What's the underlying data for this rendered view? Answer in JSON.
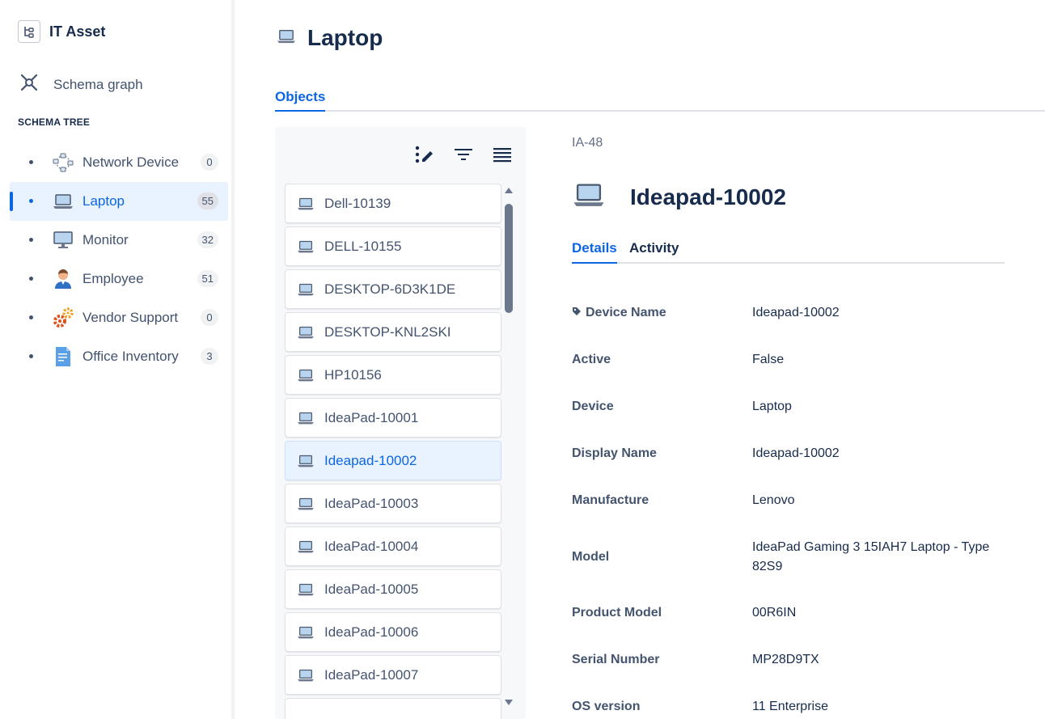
{
  "app": {
    "title": "IT Asset"
  },
  "nav": {
    "schema_graph": "Schema graph",
    "schema_tree_heading": "SCHEMA TREE"
  },
  "tree": [
    {
      "label": "Network Device",
      "count": "0",
      "icon": "network-device-icon"
    },
    {
      "label": "Laptop",
      "count": "55",
      "icon": "laptop-icon",
      "active": true
    },
    {
      "label": "Monitor",
      "count": "32",
      "icon": "monitor-icon"
    },
    {
      "label": "Employee",
      "count": "51",
      "icon": "employee-icon"
    },
    {
      "label": "Vendor Support",
      "count": "0",
      "icon": "gears-icon"
    },
    {
      "label": "Office Inventory",
      "count": "3",
      "icon": "document-icon"
    }
  ],
  "page": {
    "title": "Laptop",
    "tab_objects": "Objects"
  },
  "objects": [
    "Dell-10139",
    "DELL-10155",
    "DESKTOP-6D3K1DE",
    "DESKTOP-KNL2SKI",
    "HP10156",
    "IdeaPad-10001",
    "Ideapad-10002",
    "IdeaPad-10003",
    "IdeaPad-10004",
    "IdeaPad-10005",
    "IdeaPad-10006",
    "IdeaPad-10007"
  ],
  "selected_object": "Ideapad-10002",
  "detail": {
    "key": "IA-48",
    "title": "Ideapad-10002",
    "tab_details": "Details",
    "tab_activity": "Activity",
    "attributes": [
      {
        "label": "Device Name",
        "value": "Ideapad-10002",
        "tag": true
      },
      {
        "label": "Active",
        "value": "False"
      },
      {
        "label": "Device",
        "value": "Laptop"
      },
      {
        "label": "Display Name",
        "value": "Ideapad-10002"
      },
      {
        "label": "Manufacture",
        "value": "Lenovo"
      },
      {
        "label": "Model",
        "value": "IdeaPad Gaming 3 15IAH7 Laptop - Type 82S9"
      },
      {
        "label": "Product Model",
        "value": "00R6IN"
      },
      {
        "label": "Serial Number",
        "value": "MP28D9TX"
      },
      {
        "label": "OS version",
        "value": "11 Enterprise"
      }
    ]
  },
  "colors": {
    "accent": "#0c66e4",
    "selected_bg": "#e9f2ff",
    "panel_bg": "#f7f8f9"
  }
}
